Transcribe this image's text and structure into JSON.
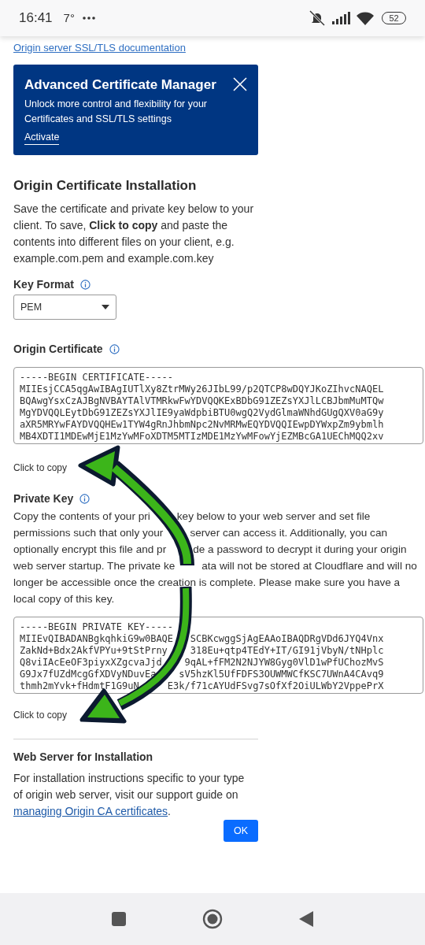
{
  "status_bar": {
    "time": "16:41",
    "temperature": "7°",
    "battery": "52"
  },
  "top_link": {
    "label": "Origin server SSL/TLS documentation"
  },
  "banner": {
    "title": "Advanced Certificate Manager",
    "text": "Unlock more control and flexibility for your Certificates and SSL/TLS settings",
    "link": "Activate"
  },
  "installation": {
    "title": "Origin Certificate Installation",
    "intro": "Save the certificate and private key below to your client. To save, **Click to copy** and paste the contents into different files on your client, e.g. example.com.pem and example.com.key"
  },
  "key_format": {
    "label": "Key Format",
    "value": "PEM"
  },
  "certificate": {
    "label": "Origin Certificate",
    "lines": [
      {
        "left": "-----BEGIN CERTIFICATE-----"
      },
      {
        "left": "MIIEsjCCA5qgAwIBAgIUTlXy8ZtrMWy26JIbL99/p2QTCP8wDQYJKoZIhvcNAQEL"
      },
      {
        "left": "BQAwgYsxCzAJBgNVBAYTAlVTMRkwFwYDVQQKExBDbG91ZEZsYXJlLCBJbmMuMTQw"
      },
      {
        "left": "MgYDVQQLEytDbG91ZEZsYXJlIE9yaWdpbiBTU0wgQ2VydGlmaWNhdGUgQXV0aG9y"
      },
      {
        "left": "aXR5MRYwFAYDVQQHEw1TYW4gRnJhbmNpc2NvMRMwEQYDVQQIEwpDYWxpZm9ybmlh"
      },
      {
        "left": "MB4XDTI1MDEwMjE1MzYwMFoXDTM5MTIzMDE1MzYwMFowYjEZMBcGA1UEChMQQ2xv"
      }
    ],
    "copy": "Click to copy"
  },
  "private_key": {
    "label": "Private Key",
    "text_lines": [
      {
        "left": "Copy the contents of your pri",
        "right": "key below to your web server and set file"
      },
      {
        "left": "permissions such that only your",
        "right": "server can access it. Additionally, you can"
      },
      {
        "left": "optionally encrypt this file and pr",
        "right": "de a password to decrypt it during your origin"
      },
      {
        "left": "web server startup. The private ke",
        "right": "ata will not be stored at Cloudflare and will no"
      },
      {
        "left": "longer be accessible once the creation is complete. Please make sure you have a"
      },
      {
        "left": "local copy of this key."
      }
    ],
    "lines": [
      {
        "left": "-----BEGIN PRIVATE KEY-----"
      },
      {
        "left": "MIIEvQIBADANBgkqhkiG9w0BAQE",
        "right": "SCBKcwggSjAgEAAoIBAQDRgVDd6JYQ4Vnx"
      },
      {
        "left": "ZakNd+Bdx2AkfVPYu+9tStPrny",
        "right": "318Eu+qtp4TEdY+IT/GI91jVbyN/tNHplc"
      },
      {
        "left": "Q8viIAcEeOF3piyxXZgcvaJjd",
        "right": "9qAL+fFM2N2NJYW8Gyg0VlD1wPfUChozMvS"
      },
      {
        "left": "G9Jx7fUZdMcgGfXDVyNDuvEa",
        "right": "sV5hzKl5UfFDFS3OUWMWCfKSC7UWnA4CAvq9"
      },
      {
        "left": "thmh2mYvk+fHdmtF1G9uN",
        "right": "E3k/f71cAYUdFSvg7sOfXf2OiULWbY2VppePrX"
      }
    ],
    "copy": "Click to copy"
  },
  "web_server": {
    "title": "Web Server for Installation",
    "text": "For installation instructions specific to your type of origin web server, visit our support guide on",
    "link": "managing Origin CA certificates",
    "tail": "."
  },
  "ok_button": "OK"
}
